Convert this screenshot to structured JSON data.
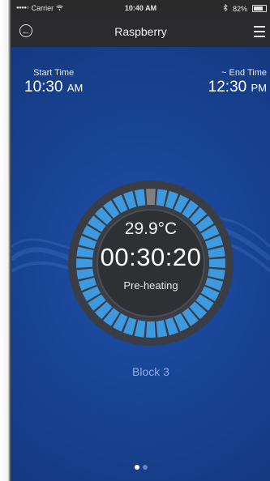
{
  "status_bar": {
    "carrier": "Carrier",
    "wifi_icon": "wifi-icon",
    "time": "10:40 AM",
    "bluetooth_icon": "bluetooth-icon",
    "battery": "82%"
  },
  "nav": {
    "back_icon": "back-arrow-icon",
    "title": "Raspberry",
    "menu_icon": "hamburger-menu-icon"
  },
  "start_time": {
    "label": "Start Time",
    "value": "10:30",
    "ampm": "AM"
  },
  "end_time": {
    "label": "~ End Time",
    "value": "12:30",
    "ampm": "PM"
  },
  "progress_ring": {
    "segments_total": 40,
    "segments_done": 1,
    "active_color": "#3d9ae0",
    "done_color": "#7f7f7f",
    "temperature": "29.9°C",
    "timer": "00:30:20",
    "status": "Pre-heating"
  },
  "block_label": "Block 3",
  "pager": {
    "pages": 2,
    "current": 1
  },
  "colors": {
    "background": "#163f8c",
    "nav_bar": "#2b2b2d",
    "ring_segment": "#3d9ae0",
    "ring_bezel": "#3a3d44",
    "ring_center": "#2e3034"
  }
}
